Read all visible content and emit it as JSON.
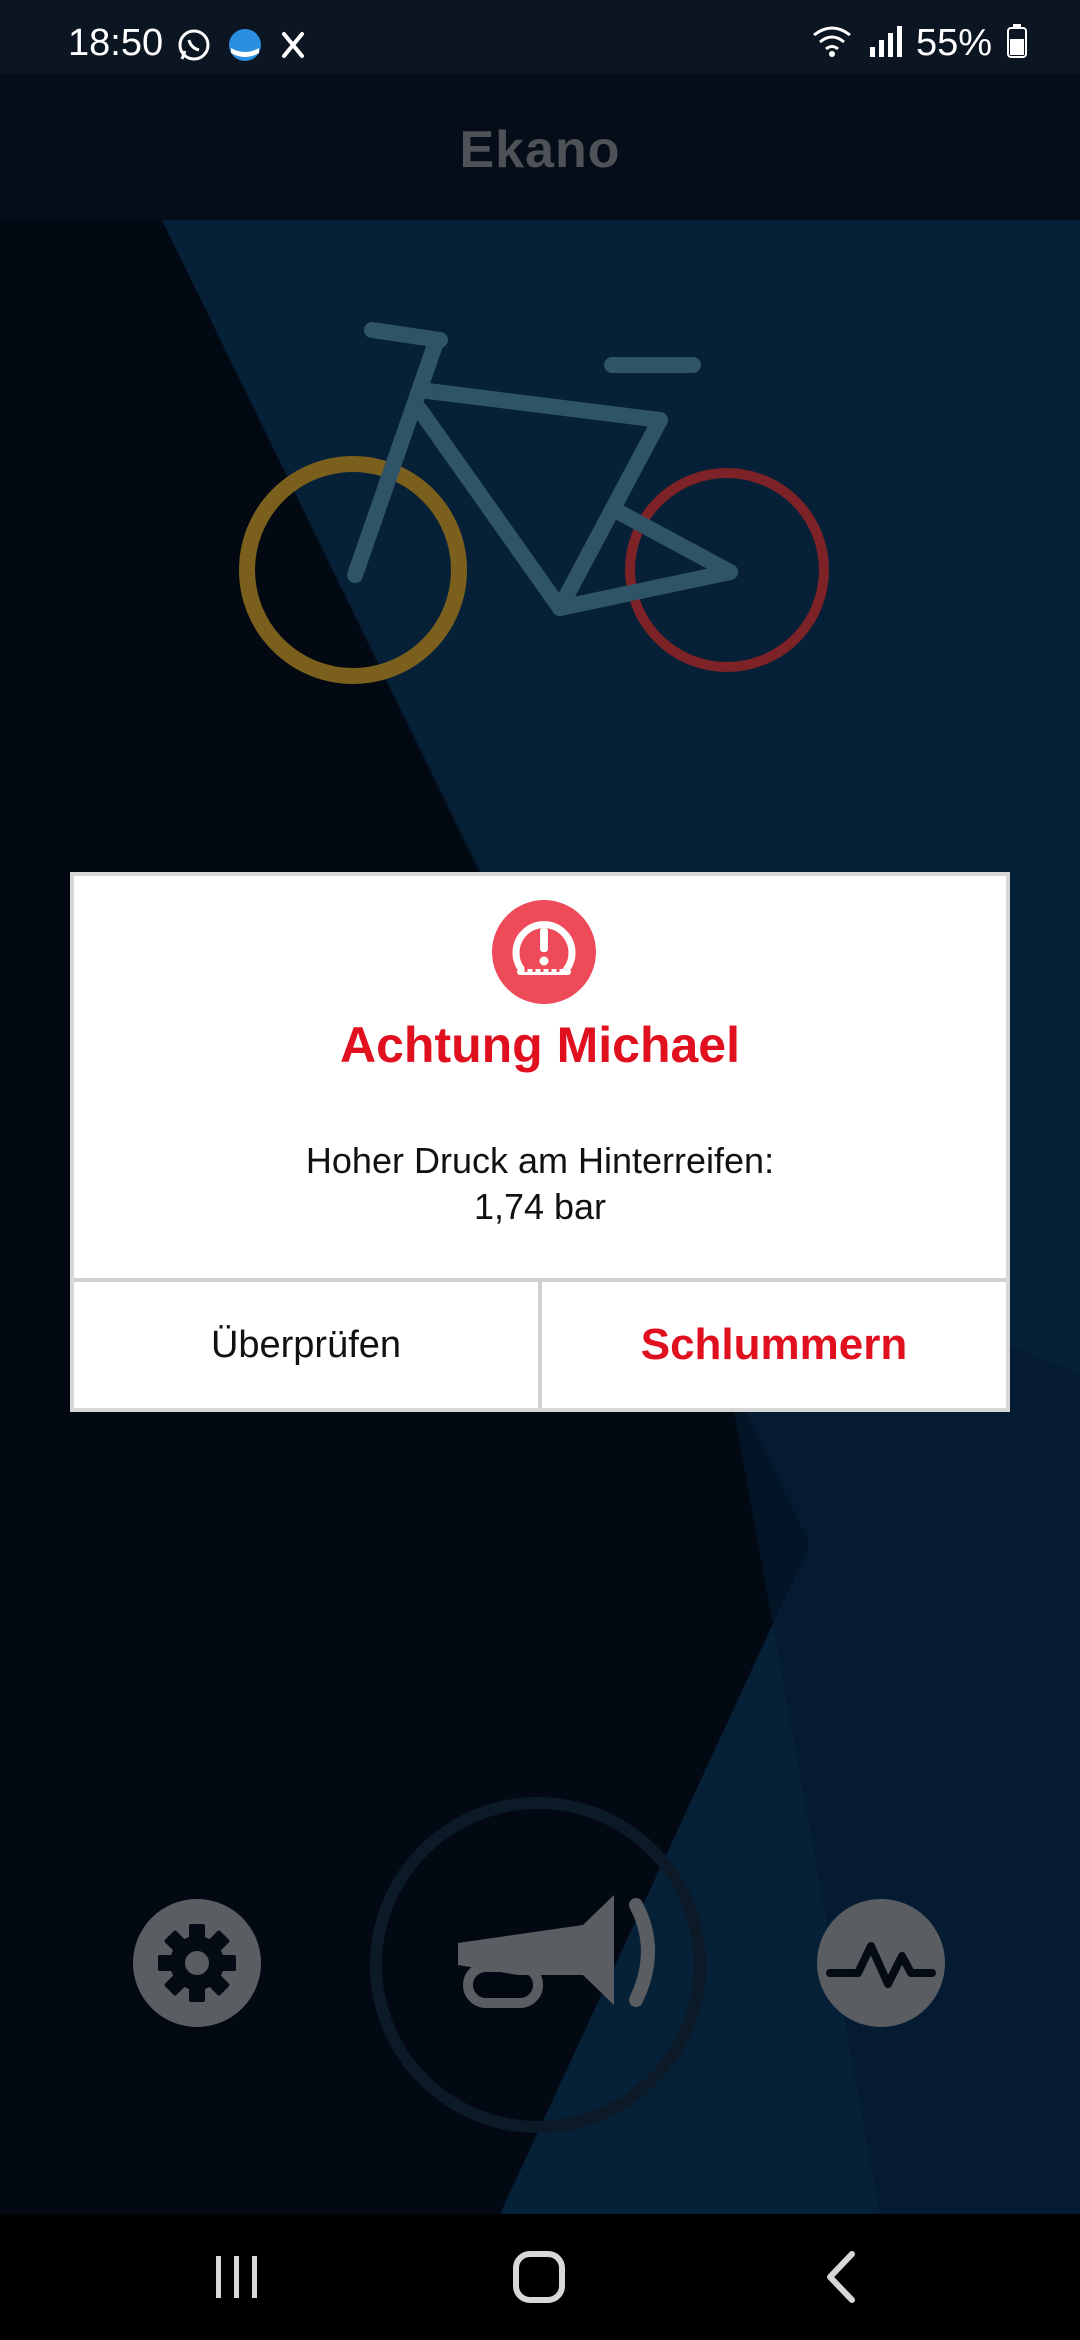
{
  "status_bar": {
    "time": "18:50",
    "battery": "55%",
    "icons": [
      "whatsapp-icon",
      "browser-icon",
      "x-icon",
      "wifi-icon",
      "signal-icon",
      "battery-icon"
    ]
  },
  "app": {
    "title": "Ekano"
  },
  "bike": {
    "front_wheel_color": "#8a6a1e",
    "rear_wheel_color": "#8a2225",
    "frame_color": "#2f5468"
  },
  "dialog": {
    "icon": "tire-pressure-warning-icon",
    "accent_color": "#e0101f",
    "title": "Achtung Michael",
    "message_line1": "Hoher Druck am Hinterreifen:",
    "message_line2": "1,74 bar",
    "secondary_label": "Überprüfen",
    "primary_label": "Schlummern"
  },
  "controls": {
    "settings": "gear-icon",
    "horn": "horn-icon",
    "activity": "activity-icon"
  },
  "nav": {
    "recents": "recents-icon",
    "home": "home-icon",
    "back": "back-icon"
  }
}
